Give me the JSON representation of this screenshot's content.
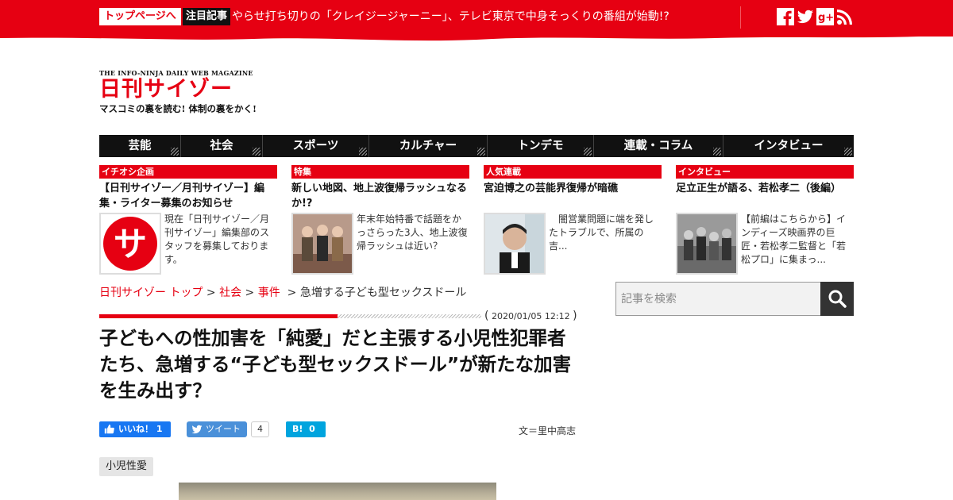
{
  "topbar": {
    "home_label": "トップページへ",
    "pick_label": "注目記事",
    "headline": "やらせ打ち切りの「クレイジージャーニー」、テレビ東京で中身そっくりの番組が始動!?",
    "sns_icons": [
      "facebook-icon",
      "twitter-icon",
      "google-plus-icon",
      "rss-icon"
    ]
  },
  "logo": {
    "tagline": "THE INFO-NINJA DAILY WEB MAGAZINE",
    "name": "日刊サイゾー",
    "subtitle": "マスコミの裏を読む! 体制の裏をかく!"
  },
  "nav": {
    "items": [
      "芸能",
      "社会",
      "スポーツ",
      "カルチャー",
      "トンデモ",
      "連載・コラム",
      "インタビュー"
    ]
  },
  "cards": [
    {
      "tag": "イチオシ企画",
      "title": "【日刊サイゾー／月刊サイゾー】編集・ライター募集のお知らせ",
      "text": "現在「日刊サイゾー／月刊サイゾー」編集部のスタッフを募集しております。"
    },
    {
      "tag": "特集",
      "title": "新しい地図、地上波復帰ラッシュなるか!?",
      "text": "年末年始特番で話題をかっさらった3人、地上波復帰ラッシュは近い？"
    },
    {
      "tag": "人気連載",
      "title": "宮迫博之の芸能界復帰が暗礁",
      "text": "闇営業問題に端を発したトラブルで、所属の吉..."
    },
    {
      "tag": "インタビュー",
      "title": "足立正生が語る、若松孝二（後編）",
      "text": "【前編はこちらから】インディーズ映画界の巨匠・若松孝二監督と「若松プロ」に集まっ..."
    }
  ],
  "breadcrumb": {
    "home": "日刊サイゾー トップ",
    "sep1": " > ",
    "cat": "社会",
    "sep2": " > ",
    "sub": "事件",
    "sep3": "  > ",
    "current": "急増する子ども型セックスドール"
  },
  "search": {
    "placeholder": "記事を検索"
  },
  "article": {
    "date": "2020/01/05 12:12",
    "paren_open": "(",
    "paren_close": ")",
    "headline": "子どもへの性加害を「純愛」だと主張する小児性犯罪者たち、急増する“子ども型セックスドール”が新たな加害を生み出す？",
    "like_label": "いいね！",
    "like_count": "1",
    "tweet_label": "ツイート",
    "tweet_count": "4",
    "hatena_label": "B!",
    "hatena_count": "0",
    "author": "文＝里中高志",
    "tag": "小児性愛"
  },
  "colors": {
    "brand_red": "#e60012",
    "nav_black": "#111111",
    "facebook_blue": "#1877f2",
    "hatena_blue": "#00a4de"
  }
}
